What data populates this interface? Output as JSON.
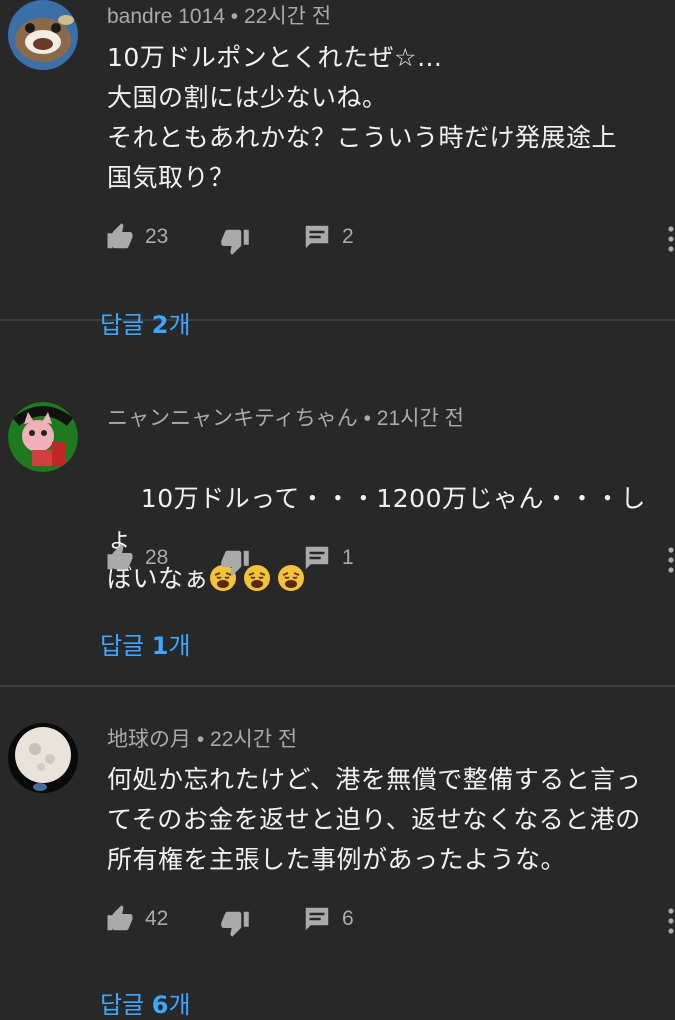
{
  "comments": [
    {
      "author": "bandre 1014",
      "dot": "•",
      "time": "22시간 전",
      "text": "10万ドルポンとくれたぜ☆…\n大国の割には少ないね。\nそれともあれかな？こういう時だけ発展途上\n国気取り？",
      "likes": "23",
      "reply_count": "2",
      "replies_prefix": "답글 ",
      "replies_num": "2",
      "replies_suffix": "개"
    },
    {
      "author": "ニャンニャンキティちゃん",
      "dot": "•",
      "time": "21시간 전",
      "text": "10万ドルって・・・1200万じゃん・・・しょ\nぼいなぁ",
      "emoji_count": 3,
      "likes": "28",
      "reply_count": "1",
      "replies_prefix": "답글 ",
      "replies_num": "1",
      "replies_suffix": "개"
    },
    {
      "author": "地球の月",
      "dot": "•",
      "time": "22시간 전",
      "text": "何処か忘れたけど、港を無償で整備すると言っ\nてそのお金を返せと迫り、返せなくなると港の\n所有権を主張した事例があったような。",
      "likes": "42",
      "reply_count": "6",
      "replies_prefix": "답글 ",
      "replies_num": "6",
      "replies_suffix": "개"
    }
  ],
  "icons": {
    "like": "thumbs-up-icon",
    "dislike": "thumbs-down-icon",
    "reply": "comment-icon",
    "more": "more-vert-icon",
    "emoji": "weary-face-emoji"
  },
  "colors": {
    "background": "#282828",
    "divider": "#3d3d3d",
    "meta": "#aaaaaa",
    "text": "#f1f1f1",
    "link": "#3ea6ff"
  }
}
